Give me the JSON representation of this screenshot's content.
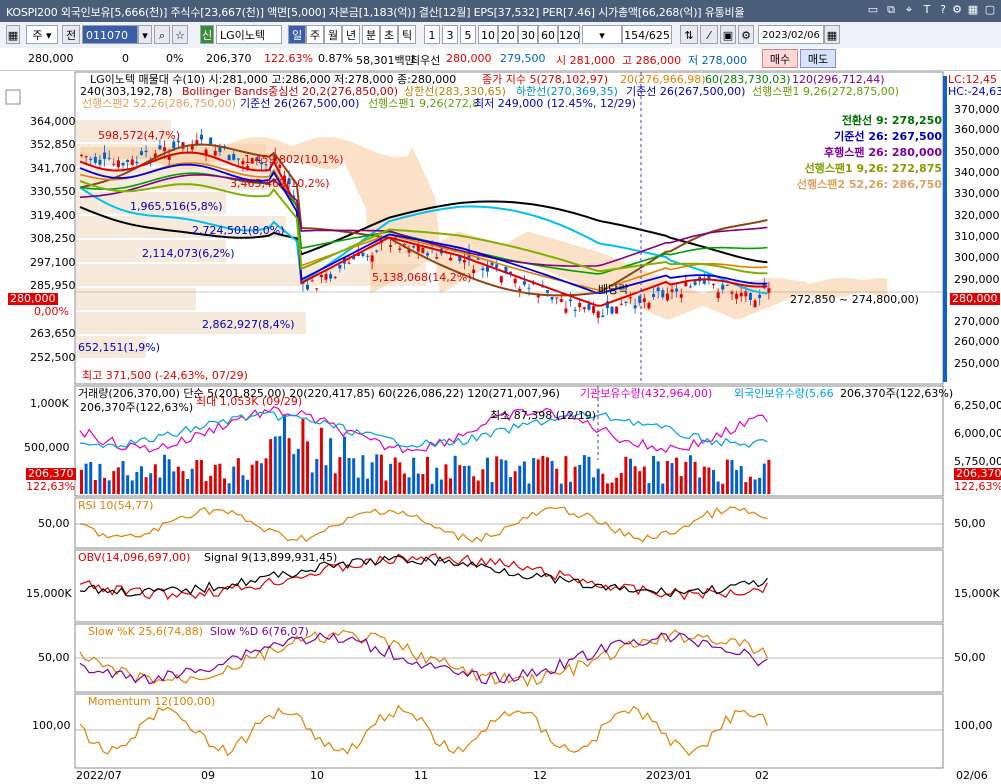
{
  "titlebar": {
    "text": "KOSPI200 외국인보유[5,666(천)] 주식수[23,667(천)] 액면[5,000] 자본금[1,183(억)] 결산[12월] EPS[37,532] PER[7.46] 시가총액[66,268(억)] 유통비율",
    "icons": [
      "minimize-icon",
      "restore-icon",
      "pin-icon",
      "help-icon",
      "font-icon",
      "settings-icon",
      "close-icon"
    ]
  },
  "toolbar": {
    "jong_label": "주",
    "jeon_label": "전",
    "code_value": "011070",
    "stock_name": "LG이노텍",
    "sin_label": "신",
    "periods": [
      "일",
      "주",
      "월",
      "년",
      "분",
      "초",
      "틱"
    ],
    "minutes": [
      "1",
      "3",
      "5",
      "10",
      "20",
      "30",
      "60",
      "120"
    ],
    "page_count": "154/625",
    "date_value": "2023/02/06",
    "buy_label": "매수",
    "sell_label": "매도"
  },
  "quote": {
    "price": "280,000",
    "change": "0",
    "change_pct": "0%",
    "volume": "206,370",
    "vol_ratio": "122.63%",
    "turnover": "0.87%",
    "amount": "58,301백만",
    "best_label": "최우선",
    "best_ask": "280,000",
    "best_bid": "279,500",
    "open": "시 281,000",
    "high": "고 286,000",
    "low": "저 278,000"
  },
  "main_panel": {
    "header1": "LG이노텍 매물대 수(10)  시:281,000 고:286,000 저:278,000 종:280,000",
    "ma_label": "종가 지수 5(278,102,97)",
    "ma20": "20(276,966,98)",
    "ma60": "60(283,730,03)",
    "ma120": "120(296,712,44)",
    "header2_a": "240(303,192,78)",
    "header2_b": "Bollinger Bands중심선 20,2(276,850,00)",
    "header2_c": "상한선(283,330,65)",
    "header2_d": "하한선(270,369,35)",
    "header2_e": "기준선 26(267,500,00)",
    "header2_f": "선행스팬1 9,26(272,875,00)",
    "header3_a": "선행스팬2 52,26(286,750,00)",
    "header3_b": "기준선 26(267,500,00)",
    "header3_c": "선행스팬1 9,26(272,8",
    "header3_d": "최저 249,000 (12.45%, 12/29)",
    "lc_label": "LC:12,45",
    "hc_label": "HC:-24,63",
    "ichimoku_legend": [
      {
        "text": "전환선 9: 278,250",
        "color": "#007000"
      },
      {
        "text": "기준선 26: 267,500",
        "color": "#0000c0"
      },
      {
        "text": "후행스팬 26: 280,000",
        "color": "#8000a0"
      },
      {
        "text": "선행스팬1 9,26: 272,875",
        "color": "#80a000"
      },
      {
        "text": "선행스팬2 52,26: 286,750",
        "color": "#e0a060"
      }
    ],
    "y_ticks": [
      "364,000",
      "352,850",
      "341,700",
      "330,550",
      "319,400",
      "308,250",
      "297,100",
      "285,950",
      "0,00%",
      "263,650",
      "252,500"
    ],
    "right_ticks": [
      "370,000",
      "360,000",
      "350,000",
      "340,000",
      "330,000",
      "320,000",
      "310,000",
      "300,000",
      "290,000",
      "270,000",
      "260,000",
      "250,000"
    ],
    "price_tag": "280,000",
    "volume_profile": [
      {
        "text": "598,572(4,7%)"
      },
      {
        "text": "1,459,802(10,1%)"
      },
      {
        "text": "3,465,462(10,2%)"
      },
      {
        "text": "1,965,516(5,8%)"
      },
      {
        "text": "2,724,501(8,0%)"
      },
      {
        "text": "2,114,073(6,2%)"
      },
      {
        "text": "5,138,068(14,2%)"
      },
      {
        "text": "2,862,927(8,4%)"
      },
      {
        "text": "652,151(1,9%)"
      }
    ],
    "max_note": "최고 371,500 (-24,63%, 07/29)",
    "range_note": "272,850 ~ 274,800,00)",
    "bdanggi_note": "배당락"
  },
  "volume_panel": {
    "header": "거래량(206,370,00)  단순 5(201,825,00)  20(220,417,85)  60(226,086,22)  120(271,007,96)",
    "inst_label": "기관보유수량(432,964,00)",
    "foreign_label": "외국인보유수량(5,66",
    "right_header": "206,370주(122,63%)",
    "sub_left": "206,370주(122,63%)",
    "max_note": "최대 1,053K (09/29)",
    "min_note": "최소 87,398 (12/19)",
    "y_ticks": [
      "1,000K",
      "500,000"
    ],
    "right_ticks": [
      "6,250,000",
      "6,000,000",
      "5,750,000"
    ],
    "tag_left": "206,370",
    "tag_left_pct": "122,63%",
    "tag_right": "206,370",
    "tag_right_pct": "122,63%"
  },
  "rsi_panel": {
    "header": "RSI 10(54,77)",
    "tick": "50,00",
    "tick_right": "50,00"
  },
  "obv_panel": {
    "header_a": "OBV(14,096,697,00)",
    "header_b": "Signal 9(13,899,931,45)",
    "tick": "15,000K",
    "tick_right": "15,000K"
  },
  "stoch_panel": {
    "header_a": "Slow %K 25,6(74,88)",
    "header_b": "Slow %D 6(76,07)",
    "tick": "50,00",
    "tick_right": "50,00"
  },
  "momentum_panel": {
    "header": "Momentum 12(100,00)",
    "tick": "100,00",
    "tick_right": "100,00"
  },
  "x_axis": [
    "2022/07",
    "09",
    "10",
    "11",
    "12",
    "2023/01",
    "02",
    "02/06"
  ],
  "colors": {
    "up": "#e00000",
    "down": "#0060d0",
    "ichimoku_cloud": "#f6c89a",
    "accent": "#3a5fa8"
  }
}
